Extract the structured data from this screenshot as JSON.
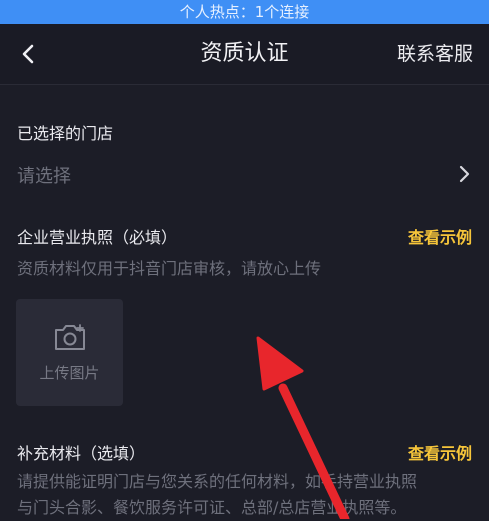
{
  "status_bar": {
    "hotspot_text": "个人热点：1个连接"
  },
  "nav": {
    "title": "资质认证",
    "contact_label": "联系客服"
  },
  "store": {
    "label": "已选择的门店",
    "placeholder": "请选择"
  },
  "license": {
    "label": "企业营业执照（必填）",
    "example_link": "查看示例",
    "hint": "资质材料仅用于抖音门店审核，请放心上传",
    "upload_label": "上传图片"
  },
  "supplement": {
    "label": "补充材料（选填）",
    "example_link": "查看示例",
    "hint_line1": "请提供能证明门店与您关系的任何材料，如手持营业执照",
    "hint_line2": "与门头合影、餐饮服务许可证、总部/总店营业执照等。"
  },
  "colors": {
    "accent_link": "#f6c53a",
    "hotspot_bar": "#3f8ff5",
    "annotation_arrow": "#e8262c"
  },
  "icons": [
    "back-arrow-icon",
    "chevron-right-icon",
    "camera-icon"
  ]
}
